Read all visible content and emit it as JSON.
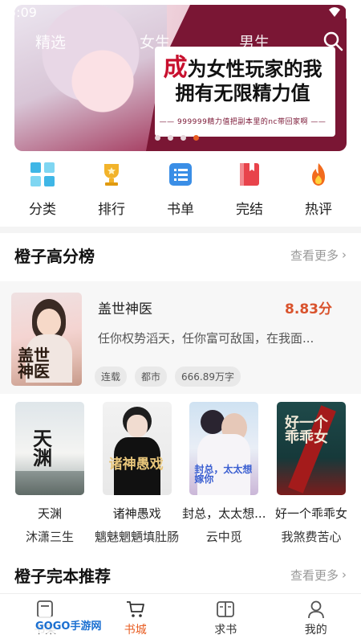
{
  "status": {
    "time": "5:09"
  },
  "tabs": [
    {
      "label": "精选"
    },
    {
      "label": "女生"
    },
    {
      "label": "男生"
    }
  ],
  "banner": {
    "title_line1_first": "成",
    "title_line1_rest": "为女性玩家的我",
    "title_line2": "拥有无限精力值",
    "subtitle": "—— 999999精力值把副本里的nc带回家啊 ——",
    "slide_count": 4,
    "active_slide": 4
  },
  "categories": [
    {
      "label": "分类",
      "icon": "grid-icon",
      "color": "#3fb6e6"
    },
    {
      "label": "排行",
      "icon": "trophy-icon",
      "color": "#f2b32a"
    },
    {
      "label": "书单",
      "icon": "list-icon",
      "color": "#3a8ee6"
    },
    {
      "label": "完结",
      "icon": "book-icon",
      "color": "#e8434b"
    },
    {
      "label": "热评",
      "icon": "flame-icon",
      "color": "#f26b1d"
    }
  ],
  "top_rated": {
    "title": "橙子高分榜",
    "more": "查看更多",
    "featured": {
      "name": "盖世神医",
      "score": "8.83分",
      "desc": "任你权势滔天，任你富可敌国，在我面...",
      "tags": [
        "连载",
        "都市",
        "666.89万字"
      ],
      "cover_text": "盖世神医"
    },
    "books": [
      {
        "title": "天渊",
        "author": "沐潇三生",
        "cover_text": "天渊"
      },
      {
        "title": "诸神愚戏",
        "author": "魑魅魍魉填肚肠",
        "cover_text": "诸神愚戏"
      },
      {
        "title": "封总，太太想...",
        "author": "云中觅",
        "cover_text": "封总，太太想嫁你"
      },
      {
        "title": "好一个乖乖女",
        "author": "我煞费苦心",
        "cover_text": "好一个乖乖女"
      }
    ]
  },
  "finished": {
    "title": "橙子完本推荐",
    "more": "查看更多"
  },
  "bottom_nav": [
    {
      "label": "书架"
    },
    {
      "label": "书城",
      "active": true
    },
    {
      "label": "求书"
    },
    {
      "label": "我的"
    }
  ],
  "watermark": "GOGO手游网"
}
